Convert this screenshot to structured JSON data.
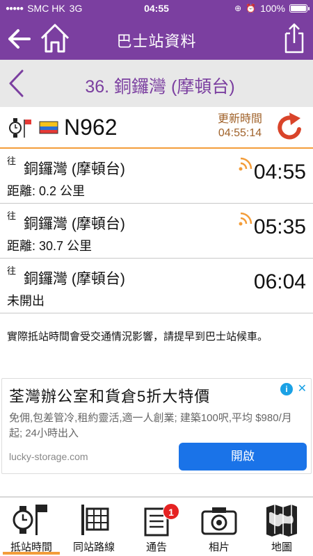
{
  "status_bar": {
    "carrier": "SMC HK",
    "network": "3G",
    "time": "04:55",
    "battery": "100%"
  },
  "nav": {
    "title": "巴士站資料"
  },
  "stop": {
    "name": "36. 銅鑼灣 (摩頓台)"
  },
  "route": {
    "number": "N962",
    "update_label": "更新時間",
    "update_time": "04:55:14"
  },
  "etas": [
    {
      "dir": "往",
      "dest": "銅鑼灣 (摩頓台)",
      "info": "距離: 0.2 公里",
      "time": "04:55",
      "realtime": true
    },
    {
      "dir": "往",
      "dest": "銅鑼灣 (摩頓台)",
      "info": "距離: 30.7 公里",
      "time": "05:35",
      "realtime": true
    },
    {
      "dir": "往",
      "dest": "銅鑼灣 (摩頓台)",
      "info": "未開出",
      "time": "06:04",
      "realtime": false
    }
  ],
  "notice": "實際抵站時間會受交通情況影響，請提早到巴士站候車。",
  "ad": {
    "title": "荃灣辦公室和貨倉5折大特價",
    "body": "免佣,包差管冷,租約靈活,適一人創業; 建築100呎,平均 $980/月起; 24小時出入",
    "url": "lucky-storage.com",
    "cta": "開啟"
  },
  "tabs": [
    {
      "label": "抵站時間",
      "icon": "watch-flag-icon",
      "active": true
    },
    {
      "label": "同站路線",
      "icon": "timetable-icon",
      "active": false
    },
    {
      "label": "通告",
      "icon": "notice-icon",
      "active": false,
      "badge": "1"
    },
    {
      "label": "相片",
      "icon": "camera-icon",
      "active": false
    },
    {
      "label": "地圖",
      "icon": "map-icon",
      "active": false
    }
  ],
  "colors": {
    "brand": "#7b3fa0",
    "accent": "#f39d3a",
    "update_text": "#a0622a",
    "refresh": "#d9442a",
    "ad_button": "#1a73e8"
  }
}
